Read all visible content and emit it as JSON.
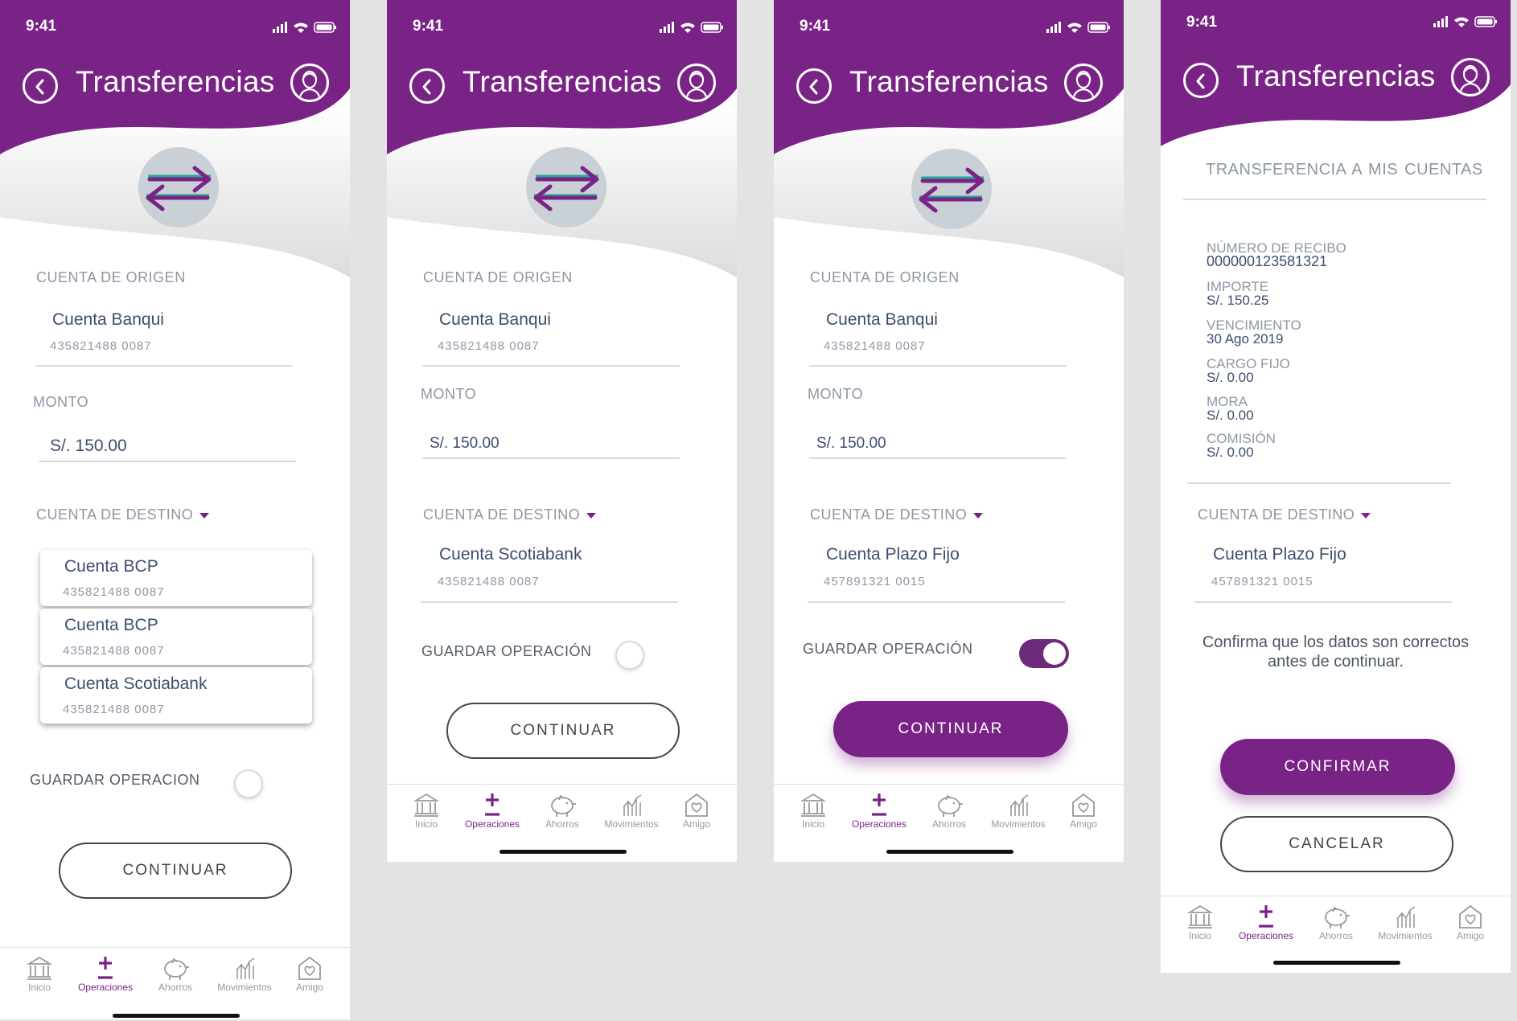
{
  "status": {
    "time": "9:41"
  },
  "header": {
    "title": "Transferencias"
  },
  "labels": {
    "origin": "CUENTA DE ORIGEN",
    "amount": "MONTO",
    "destination": "CUENTA DE DESTINO",
    "save_op_unaccented": "GUARDAR OPERACION",
    "save_op": "GUARDAR OPERACIÓN"
  },
  "origin_account": {
    "name": "Cuenta Banqui",
    "number": "435821488  0087"
  },
  "amount_value": "S/. 150.00",
  "dropdown_options": [
    {
      "name": "Cuenta BCP",
      "number": "435821488  0087"
    },
    {
      "name": "Cuenta BCP",
      "number": "435821488  0087"
    },
    {
      "name": "Cuenta Scotiabank",
      "number": "435821488  0087"
    }
  ],
  "destination_scotia": {
    "name": "Cuenta Scotiabank",
    "number": "435821488  0087"
  },
  "destination_plazo": {
    "name": "Cuenta Plazo Fijo",
    "number": "457891321  0015"
  },
  "buttons": {
    "continue": "CONTINUAR",
    "confirm": "CONFIRMAR",
    "cancel": "CANCELAR"
  },
  "toggles": {
    "screen1": false,
    "screen2": false,
    "screen3": true
  },
  "summary": {
    "title": "TRANSFERENCIA  A MIS CUENTAS",
    "receipt_label": "NÚMERO DE RECIBO",
    "receipt_value": "000000123581321",
    "importe_label": "IMPORTE",
    "importe_value": "S/. 150.25",
    "due_label": "VENCIMIENTO",
    "due_value": "30 Ago 2019",
    "fixed_label": "CARGO FIJO",
    "fixed_value": "S/. 0.00",
    "late_label": "MORA",
    "late_value": "S/. 0.00",
    "fee_label": "COMISIÓN",
    "fee_value": "S/. 0.00",
    "message": "Confirma que los datos son correctos antes de continuar."
  },
  "tabs": [
    "Inicio",
    "Operaciones",
    "Ahorros",
    "Movimientos",
    "Amigo"
  ],
  "active_tab": "Operaciones",
  "colors": {
    "primary": "#7a2386",
    "text": "#3b4e6e",
    "muted": "#8d96a3"
  }
}
